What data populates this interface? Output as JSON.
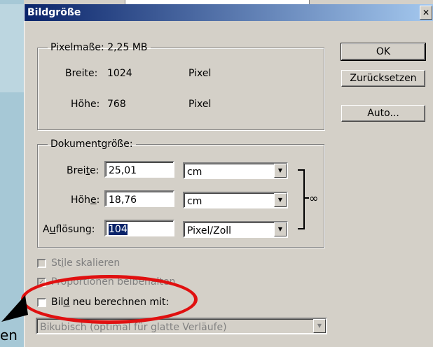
{
  "dialog": {
    "title": "Bildgröße",
    "close_symbol": "✕",
    "buttons": {
      "ok": "OK",
      "reset": "Zurücksetzen",
      "auto": "Auto..."
    }
  },
  "pixel_dimensions": {
    "legend": "Pixelmaße: 2,25 MB",
    "width_label": "Breite:",
    "width_value": "1024",
    "width_unit": "Pixel",
    "height_label": "Höhe:",
    "height_value": "768",
    "height_unit": "Pixel"
  },
  "document_size": {
    "legend": "Dokumentgröße:",
    "width_label_pre": "Brei",
    "width_label_ul": "t",
    "width_label_post": "e:",
    "width_value": "25,01",
    "width_unit": "cm",
    "height_label_pre": "Höh",
    "height_label_ul": "e",
    "height_label_post": ":",
    "height_value": "18,76",
    "height_unit": "cm",
    "res_label_pre": "A",
    "res_label_ul": "u",
    "res_label_post": "flösung:",
    "res_value": "104",
    "res_unit": "Pixel/Zoll"
  },
  "options": {
    "scale_styles_pre": "St",
    "scale_styles_ul": "i",
    "scale_styles_post": "le skalieren",
    "scale_styles_checked": false,
    "constrain_label": "Proportionen beibehalten",
    "constrain_checked": true,
    "resample_pre": "Bil",
    "resample_ul": "d",
    "resample_post": " neu berechnen mit:",
    "resample_checked": false,
    "resample_method": "Bikubisch (optimal für glatte Verläufe)"
  },
  "background_fragment": "en",
  "colors": {
    "annotation": "#e01010",
    "titlebar": "#0a246a",
    "selection": "#0a246a"
  },
  "icons": {
    "link": "chain-link-icon",
    "arrow": "annotation-arrow-icon",
    "dropdown": "dropdown-arrow-icon"
  }
}
